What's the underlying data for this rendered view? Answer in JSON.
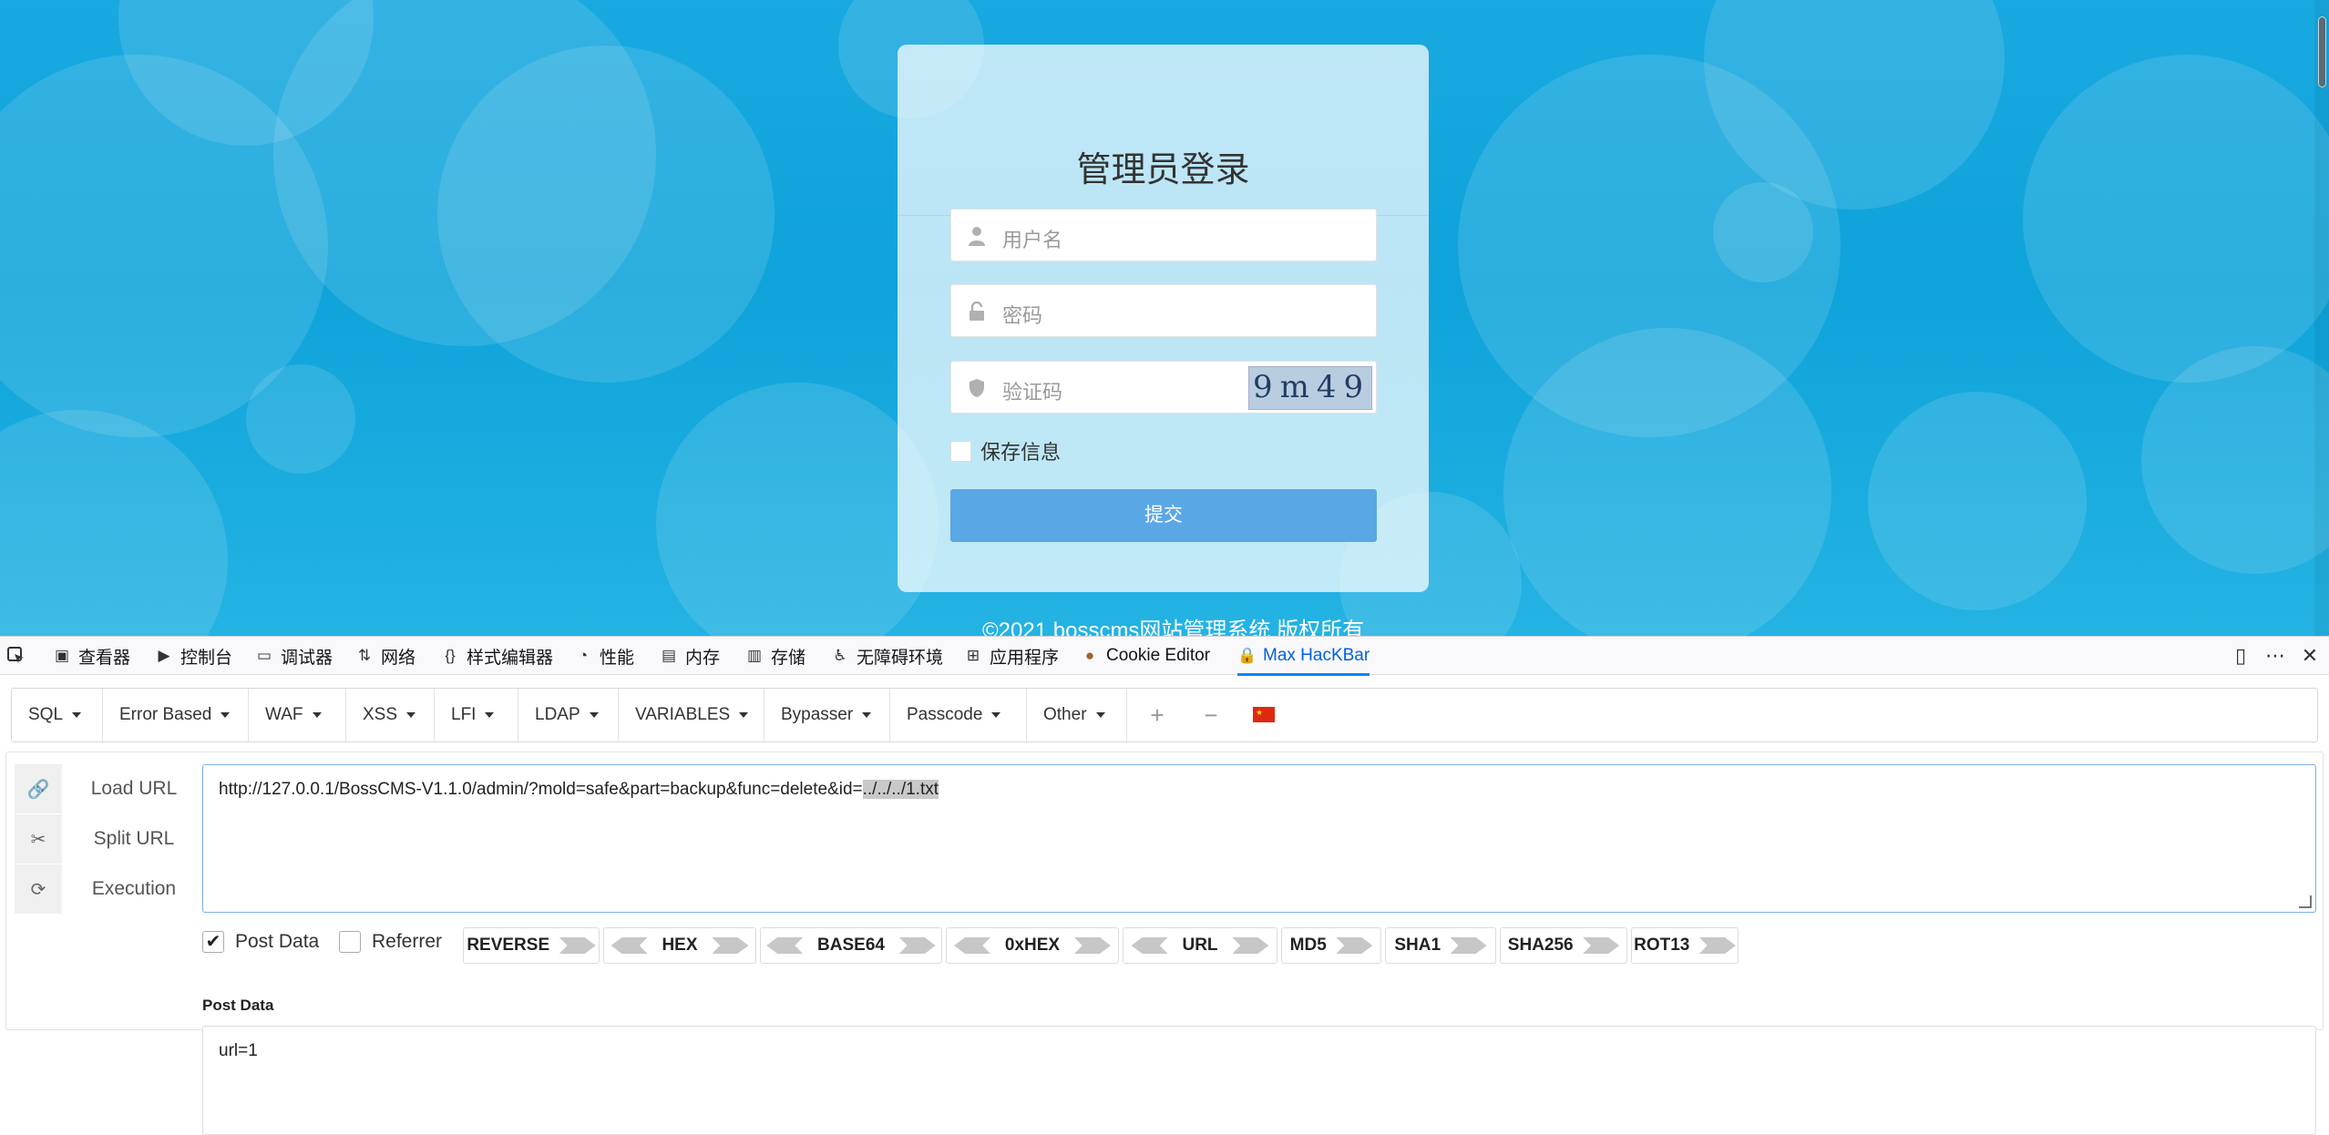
{
  "login": {
    "title": "管理员登录",
    "username_placeholder": "用户名",
    "password_placeholder": "密码",
    "captcha_placeholder": "验证码",
    "captcha_text": "9m49",
    "remember_label": "保存信息",
    "submit_label": "提交",
    "copyright": "©2021 bosscms网站管理系统 版权所有"
  },
  "devtools": {
    "tabs": [
      {
        "label": "查看器",
        "icon": "inspector-icon"
      },
      {
        "label": "控制台",
        "icon": "console-icon"
      },
      {
        "label": "调试器",
        "icon": "debugger-icon"
      },
      {
        "label": "网络",
        "icon": "network-icon"
      },
      {
        "label": "样式编辑器",
        "icon": "style-editor-icon"
      },
      {
        "label": "性能",
        "icon": "performance-icon"
      },
      {
        "label": "内存",
        "icon": "memory-icon"
      },
      {
        "label": "存储",
        "icon": "storage-icon"
      },
      {
        "label": "无障碍环境",
        "icon": "accessibility-icon"
      },
      {
        "label": "应用程序",
        "icon": "application-icon"
      },
      {
        "label": "Cookie Editor",
        "icon": "cookie-icon"
      },
      {
        "label": "Max HacKBar",
        "icon": "lock-icon"
      }
    ],
    "active_tab": "Max HacKBar"
  },
  "hackbar": {
    "menus": [
      "SQL",
      "Error Based",
      "WAF",
      "XSS",
      "LFI",
      "LDAP",
      "VARIABLES",
      "Bypasser",
      "Passcode",
      "Other"
    ],
    "actions": [
      "Load URL",
      "Split URL",
      "Execution"
    ],
    "url_prefix": "http://127.0.0.1/BossCMS-V1.1.0/admin/?mold=safe&part=backup&func=delete&id=",
    "url_selected": "../../../1.txt",
    "post_data_checked": true,
    "post_data_label": "Post Data",
    "referrer_checked": false,
    "referrer_label": "Referrer",
    "encoders": [
      "REVERSE",
      "HEX",
      "BASE64",
      "0xHEX",
      "URL",
      "MD5",
      "SHA1",
      "SHA256",
      "ROT13"
    ],
    "post_section_label": "Post Data",
    "post_body": "url=1"
  },
  "colors": {
    "page_bg": "#0ea3da",
    "submit_bg": "#5aa7e6",
    "active_tab": "#0060df"
  }
}
